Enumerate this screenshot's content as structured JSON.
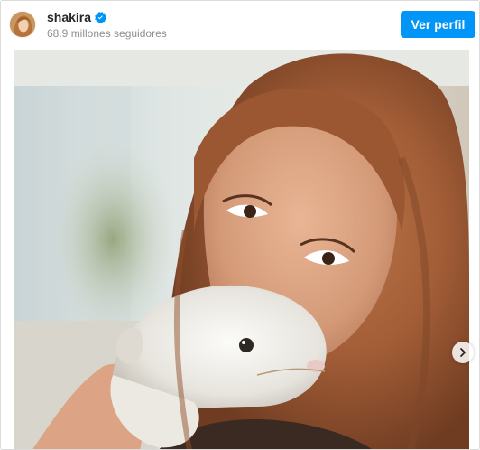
{
  "header": {
    "username": "shakira",
    "verified_icon": "verified-badge-icon",
    "followers": "68.9 millones seguidores",
    "view_profile_label": "Ver perfil"
  },
  "media": {
    "next_icon": "chevron-right-icon"
  },
  "colors": {
    "button_blue": "#0095f6",
    "username_text": "#262626",
    "secondary_text": "#8e8e8e"
  }
}
